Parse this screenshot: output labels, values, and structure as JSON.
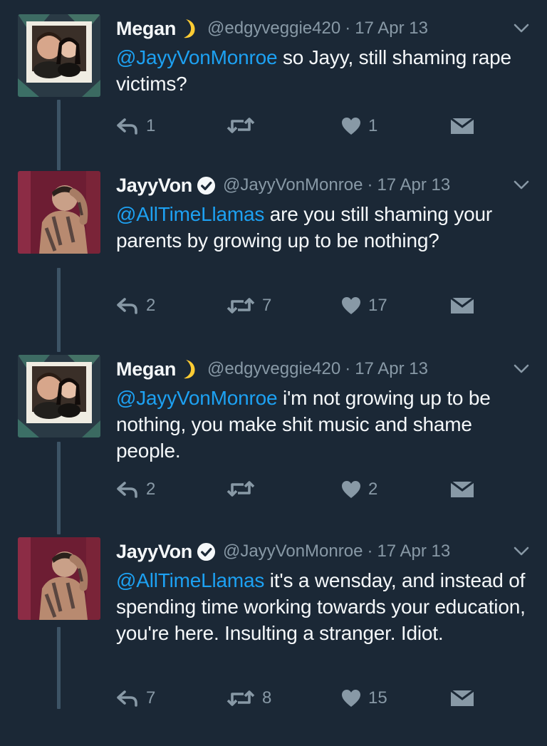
{
  "colors": {
    "background": "#1b2836",
    "text": "#f5f8fa",
    "secondary": "#8899a6",
    "mention": "#1da1f2",
    "thread_line": "#3d5466",
    "moon": "#ffcc33"
  },
  "tweets": [
    {
      "name": "Megan",
      "name_suffix_icon": "crescent-moon-emoji",
      "handle": "@edgyveggie420",
      "separator": "·",
      "date": "17 Apr 13",
      "mention": "@JayyVonMonroe",
      "text": " so Jayy, still shaming rape victims?",
      "reply_count": "1",
      "retweet_count": "",
      "like_count": "1"
    },
    {
      "name": "JayyVon",
      "name_suffix_icon": "verified-badge-icon",
      "handle": "@JayyVonMonroe",
      "separator": "·",
      "date": "17 Apr 13",
      "mention": "@AllTimeLlamas",
      "text": " are you still shaming your parents by growing up to be nothing?",
      "reply_count": "2",
      "retweet_count": "7",
      "like_count": "17"
    },
    {
      "name": "Megan",
      "name_suffix_icon": "crescent-moon-emoji",
      "handle": "@edgyveggie420",
      "separator": "·",
      "date": "17 Apr 13",
      "mention": "@JayyVonMonroe",
      "text": " i'm not growing up to be nothing, you make shit music and shame people.",
      "reply_count": "2",
      "retweet_count": "",
      "like_count": "2"
    },
    {
      "name": "JayyVon",
      "name_suffix_icon": "verified-badge-icon",
      "handle": "@JayyVonMonroe",
      "separator": "·",
      "date": "17 Apr 13",
      "mention": "@AllTimeLlamas",
      "text": " it's a wensday, and instead of spending time working towards your education, you're here. Insulting a stranger. Idiot.",
      "reply_count": "7",
      "retweet_count": "8",
      "like_count": "15"
    }
  ]
}
